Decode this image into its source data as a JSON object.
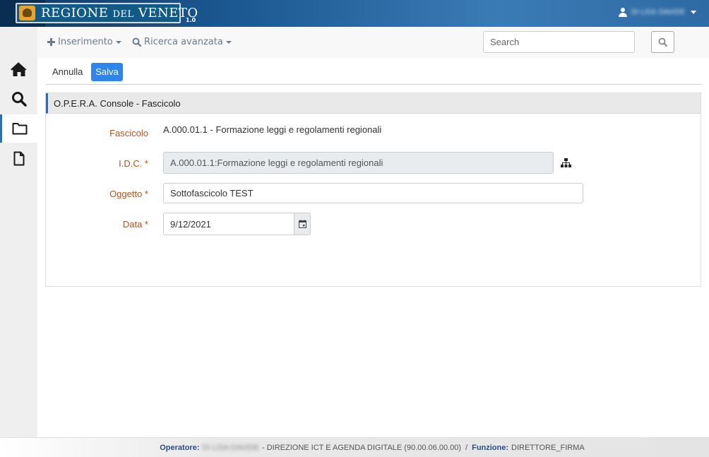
{
  "header": {
    "logo_main": "REGIONE",
    "logo_small": "DEL",
    "logo_end": "VENETO",
    "version": "1.0",
    "user_name": "DI LISA DAVIDE",
    "colors": {
      "bar": "#1d5a94",
      "accent": "#2a6fae"
    }
  },
  "sidebar": {
    "items": [
      {
        "icon": "home-icon"
      },
      {
        "icon": "search-icon"
      },
      {
        "icon": "folder-icon",
        "active": true
      },
      {
        "icon": "document-icon"
      }
    ]
  },
  "toolbar": {
    "inserimento_label": "Inserimento",
    "ricerca_label": "Ricerca avanzata",
    "search_placeholder": "Search"
  },
  "actions": {
    "annulla_label": "Annulla",
    "salva_label": "Salva",
    "salva_color": "#2f86e8"
  },
  "panel": {
    "title": "O.P.E.R.A. Console - Fascicolo",
    "fields": {
      "fascicolo": {
        "label": "Fascicolo",
        "value": "A.000.01.1 - Formazione leggi e regolamenti regionali"
      },
      "idc": {
        "label": "I.D.C. *",
        "value": "A.000.01.1:Formazione leggi e regolamenti regionali"
      },
      "oggetto": {
        "label": "Oggetto *",
        "value": "Sottofascicolo TEST"
      },
      "data": {
        "label": "Data *",
        "value": "9/12/2021"
      }
    },
    "label_color": "#b4531c"
  },
  "footer": {
    "operatore_label": "Operatore:",
    "operatore_name": "DI LISA DAVIDE",
    "direzione": "- DIREZIONE ICT E AGENDA DIGITALE (90.00.06.00.00)",
    "separator": "/",
    "funzione_label": "Funzione:",
    "funzione_value": "DIRETTORE_FIRMA"
  }
}
